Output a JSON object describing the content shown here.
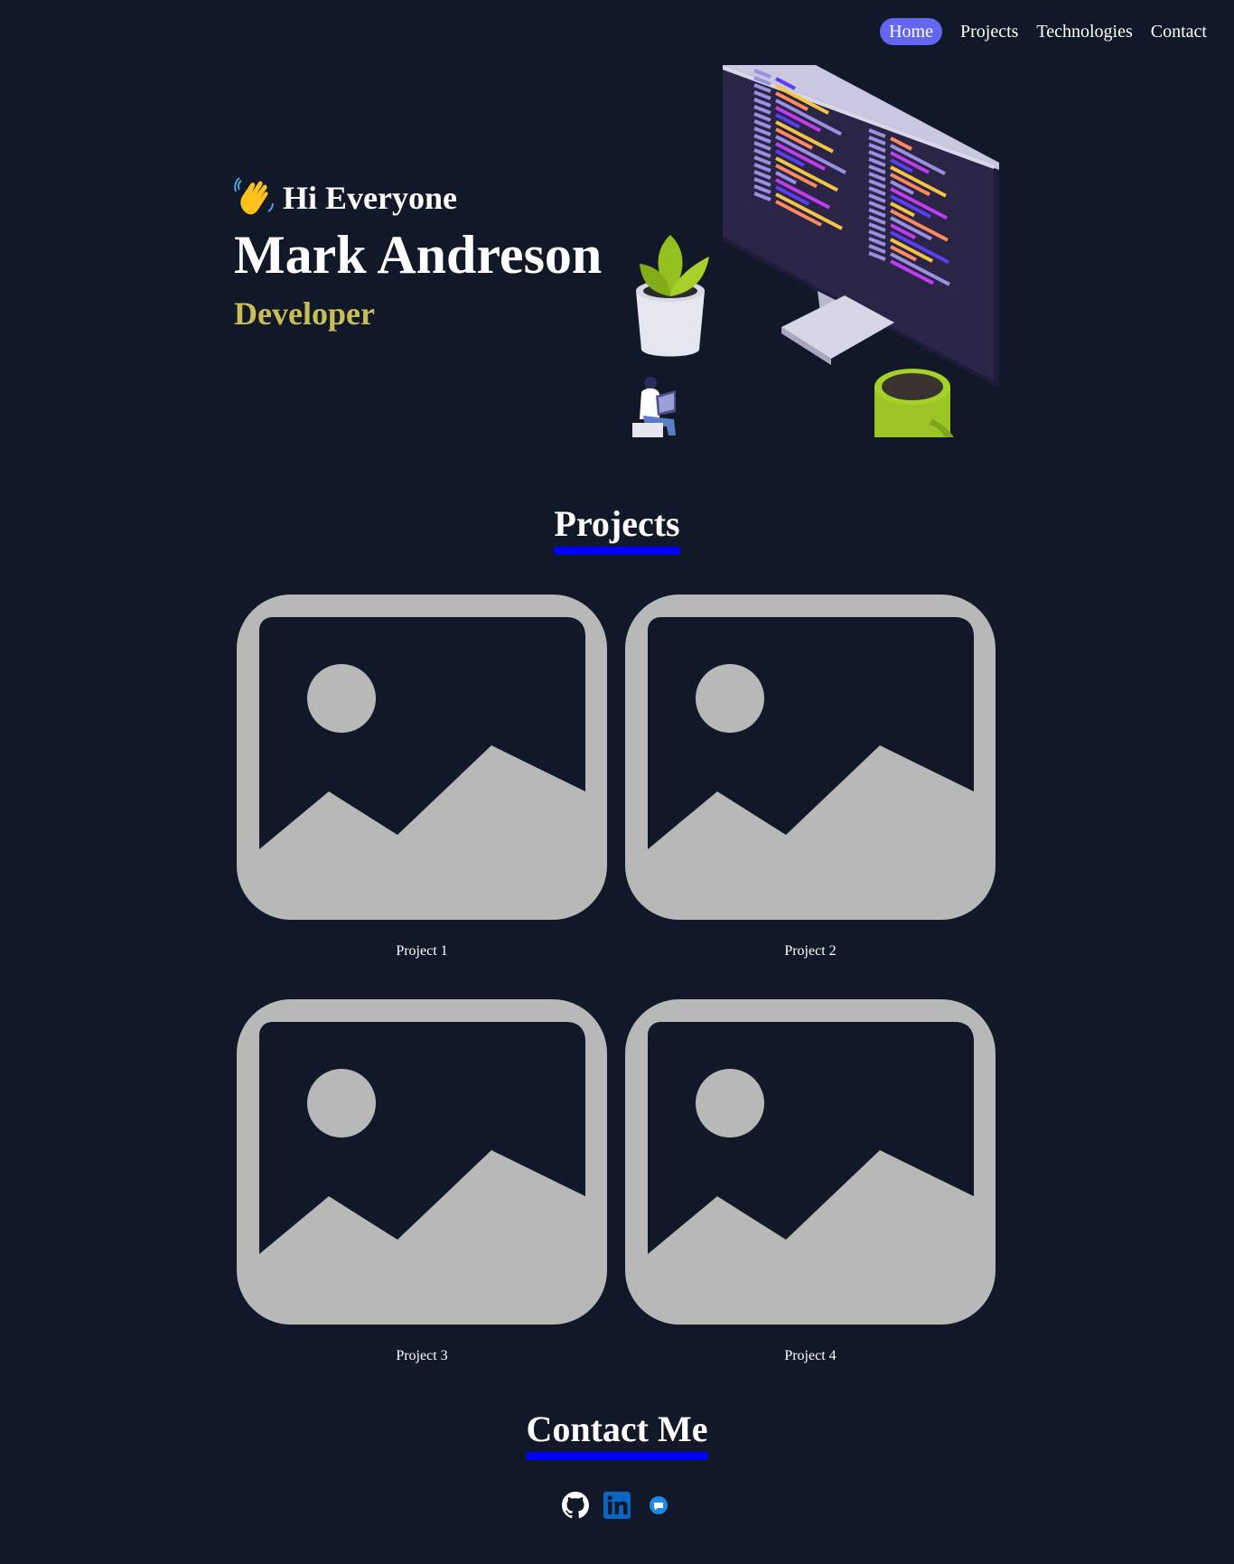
{
  "nav": {
    "items": [
      {
        "label": "Home",
        "active": true
      },
      {
        "label": "Projects",
        "active": false
      },
      {
        "label": "Technologies",
        "active": false
      },
      {
        "label": "Contact",
        "active": false
      }
    ]
  },
  "hero": {
    "greeting": "Hi Everyone",
    "greeting_icon": "waving-hand-icon",
    "name": "Mark Andreson",
    "role": "Developer",
    "illustration": "developer-desk-illustration"
  },
  "projects": {
    "title": "Projects",
    "items": [
      {
        "label": "Project 1",
        "image": "image-placeholder-icon"
      },
      {
        "label": "Project 2",
        "image": "image-placeholder-icon"
      },
      {
        "label": "Project 3",
        "image": "image-placeholder-icon"
      },
      {
        "label": "Project 4",
        "image": "image-placeholder-icon"
      }
    ]
  },
  "contact": {
    "title": "Contact Me",
    "links": [
      {
        "icon": "github-icon"
      },
      {
        "icon": "linkedin-icon"
      },
      {
        "icon": "chat-icon"
      }
    ]
  },
  "colors": {
    "background": "#111827",
    "accent": "#6366f1",
    "underline": "#0000ff",
    "role": "#c7be5a",
    "placeholder": "#b8b8b8"
  }
}
